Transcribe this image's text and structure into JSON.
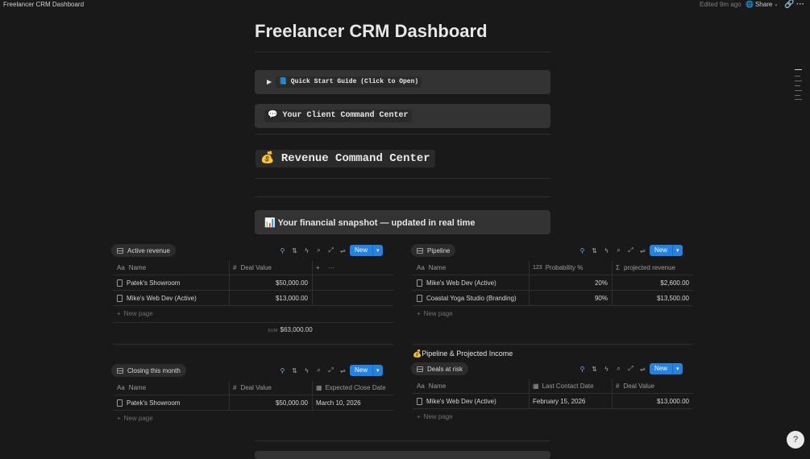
{
  "topbar": {
    "title": "Freelancer CRM Dashboard",
    "edited": "Edited 9m ago",
    "share": "Share"
  },
  "page": {
    "title": "Freelancer CRM Dashboard"
  },
  "callouts": {
    "quick_start": {
      "arrow": "▶",
      "icon": "📘",
      "text": "Quick Start Guide (Click to Open)"
    },
    "command": {
      "icon": "💬",
      "text": "Your Client Command Center"
    },
    "revenue": {
      "icon": "💰",
      "text": "Revenue Command Center"
    },
    "snapshot": {
      "icon": "📊",
      "text": "Your financial snapshot — updated in real time"
    }
  },
  "active_revenue": {
    "tab": "Active revenue",
    "new": "New",
    "columns": {
      "name_icon": "Aa",
      "name": "Name",
      "value_icon": "#",
      "value": "Deal Value",
      "add": "+",
      "more": "···"
    },
    "rows": [
      {
        "name": "Patek's Showroom",
        "value": "$50,000.00"
      },
      {
        "name": "Mike's Web Dev (Active)",
        "value": "$13,000.00"
      }
    ],
    "new_page": "New page",
    "sum_label": "SUM",
    "sum": "$63,000.00"
  },
  "pipeline": {
    "tab": "Pipeline",
    "new": "New",
    "columns": {
      "name_icon": "Aa",
      "name": "Name",
      "prob_icon": "123",
      "prob": "Probability %",
      "proj_icon": "Σ",
      "proj": "projected revenue"
    },
    "rows": [
      {
        "name": "Mike's Web Dev (Active)",
        "prob": "20%",
        "proj": "$2,600.00"
      },
      {
        "name": "Coastal Yoga Studio (Branding)",
        "prob": "90%",
        "proj": "$13,500.00"
      }
    ],
    "new_page": "New page"
  },
  "closing": {
    "tab": "Closing this month",
    "new": "New",
    "columns": {
      "name_icon": "Aa",
      "name": "Name",
      "value_icon": "#",
      "value": "Deal Value",
      "date": "Expected Close Date"
    },
    "rows": [
      {
        "name": "Patek's Showroom",
        "value": "$50,000.00",
        "date": "March 10, 2026"
      }
    ],
    "new_page": "New page"
  },
  "pipeline_income": {
    "icon": "💰",
    "heading": "Pipeline & Projected Income"
  },
  "deals_risk": {
    "tab": "Deals at risk",
    "new": "New",
    "columns": {
      "name_icon": "Aa",
      "name": "Name",
      "contact": "Last Contact Date",
      "value_icon": "#",
      "value": "Deal Value"
    },
    "rows": [
      {
        "name": "Mike's Web Dev (Active)",
        "contact": "February 15, 2026",
        "value": "$13,000.00"
      }
    ],
    "new_page": "New page"
  },
  "icons": {
    "share": "globe-icon",
    "link": "link-icon",
    "more": "more-icon",
    "filter": "filter-icon",
    "sort": "sort-icon",
    "automation": "lightning-icon",
    "search": "search-icon",
    "expand": "expand-icon",
    "settings": "settings-icon"
  },
  "colors": {
    "accent": "#2383e2",
    "background": "#191919"
  }
}
